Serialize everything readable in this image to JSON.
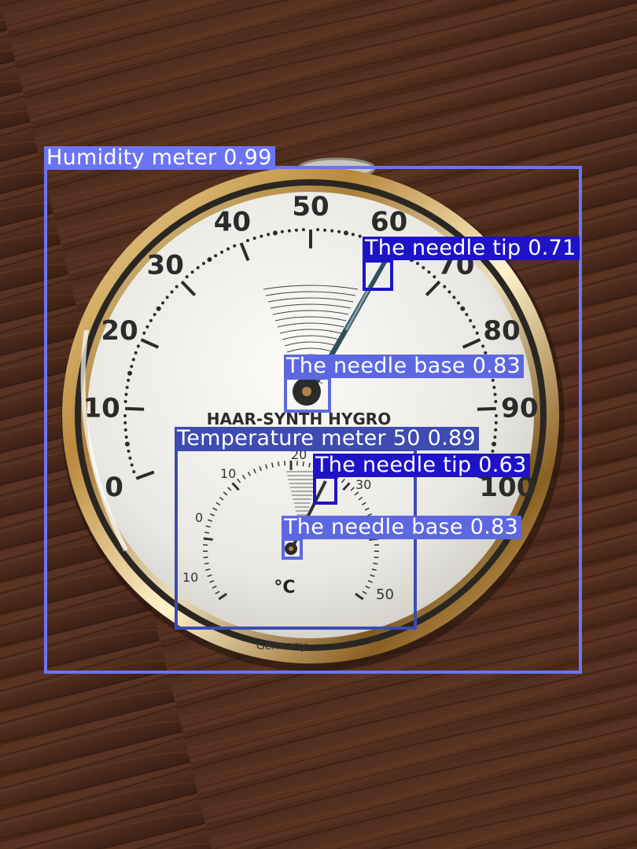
{
  "dial": {
    "humidity_scale": [
      "0",
      "10",
      "20",
      "30",
      "40",
      "50",
      "60",
      "70",
      "80",
      "90",
      "100"
    ],
    "temperature_scale": [
      "10",
      "0",
      "10",
      "20",
      "30",
      "50"
    ],
    "unit": "°C",
    "brand": "HAAR-SYNTH HYGRO",
    "origin": "Germany"
  },
  "detections": [
    {
      "label": "Humidity meter 0.99",
      "color": "#6c74f4"
    },
    {
      "label": "The needle tip 0.71",
      "color": "#1f13c8"
    },
    {
      "label": "The needle base 0.83",
      "color": "#5d68e0"
    },
    {
      "label": "Temperature meter 50 0.89",
      "color": "#3e4bb0"
    },
    {
      "label": "The needle tip 0.63",
      "color": "#1f13c8"
    },
    {
      "label": "The needle base 0.83",
      "color": "#5d68e0"
    }
  ]
}
